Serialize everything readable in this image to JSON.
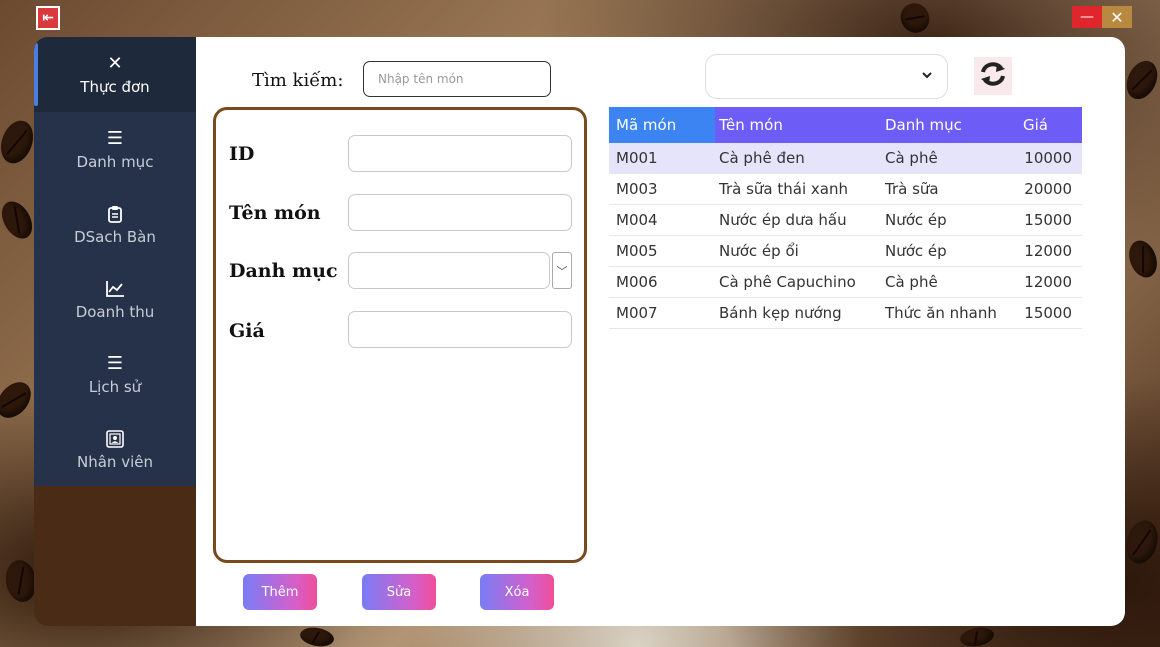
{
  "window": {
    "controls": {
      "minimize": "—",
      "close": "✕"
    }
  },
  "sidebar": {
    "items": [
      {
        "label": "Thực đơn",
        "icon": "utensils-icon",
        "active": true
      },
      {
        "label": "Danh mục",
        "icon": "list-icon"
      },
      {
        "label": "DSach Bàn",
        "icon": "clipboard-icon"
      },
      {
        "label": "Doanh thu",
        "icon": "chart-line-icon"
      },
      {
        "label": "Lịch sử",
        "icon": "list-icon"
      },
      {
        "label": "Nhân viên",
        "icon": "employee-badge-icon"
      }
    ]
  },
  "search": {
    "label": "Tìm kiếm:",
    "placeholder": "Nhập tên món",
    "value": ""
  },
  "form": {
    "id_label": "ID",
    "name_label": "Tên món",
    "category_label": "Danh mục",
    "price_label": "Giá"
  },
  "buttons": {
    "add": "Thêm",
    "edit": "Sửa",
    "delete": "Xóa"
  },
  "filter": {
    "selected": ""
  },
  "table": {
    "headers": [
      "Mã món",
      "Tên món",
      "Danh mục",
      "Giá"
    ],
    "rows": [
      [
        "M001",
        "Cà phê đen",
        "Cà phê",
        "10000"
      ],
      [
        "M003",
        "Trà sữa thái xanh",
        "Trà sữa",
        "20000"
      ],
      [
        "M004",
        "Nước ép dưa hấu",
        "Nước ép",
        "15000"
      ],
      [
        "M005",
        "Nước ép ổi",
        "Nước ép",
        "12000"
      ],
      [
        "M006",
        "Cà phê Capuchino",
        "Cà phê",
        "12000"
      ],
      [
        "M007",
        "Bánh kẹp nướng",
        "Thức ăn nhanh",
        "15000"
      ]
    ]
  },
  "colors": {
    "sidebar": "#26324a",
    "form_border": "#7a4a1c",
    "table_header": "#6d5cf6",
    "table_header_first": "#3b84f1",
    "button_gradient_start": "#7a7cf5",
    "button_gradient_end": "#f04e9a"
  }
}
